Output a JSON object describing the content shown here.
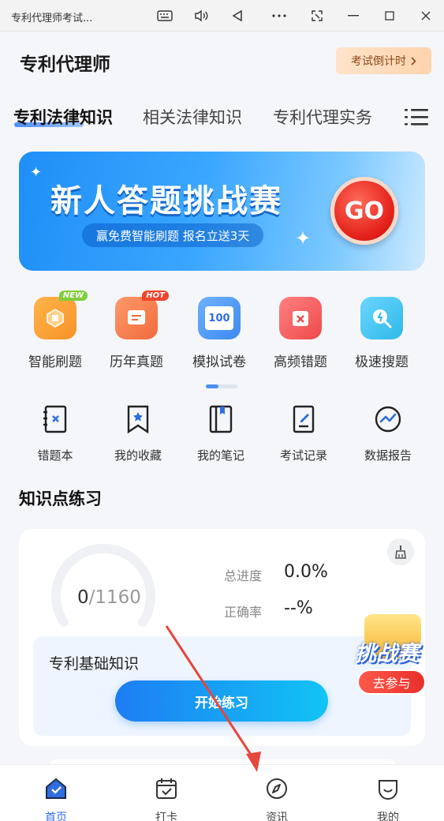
{
  "window": {
    "title": "专利代理师考试..."
  },
  "header": {
    "title": "专利代理师",
    "countdown_label": "考试倒计时"
  },
  "tabs": [
    {
      "label": "专利法律知识",
      "active": true
    },
    {
      "label": "相关法律知识",
      "active": false
    },
    {
      "label": "专利代理实务",
      "active": false
    }
  ],
  "banner": {
    "title": "新人答题挑战赛",
    "subtitle": "赢免费智能刷题 报名立送3天",
    "go_label": "GO"
  },
  "features": [
    {
      "label": "智能刷题",
      "badge": "NEW",
      "icon": "smart-practice-icon",
      "color": "#f7932b"
    },
    {
      "label": "历年真题",
      "badge": "HOT",
      "icon": "past-papers-icon",
      "color": "#f06a3c"
    },
    {
      "label": "模拟试卷",
      "badge": "",
      "icon": "mock-exam-icon",
      "icon_text": "100",
      "color": "#3b8af0"
    },
    {
      "label": "高频错题",
      "badge": "",
      "icon": "frequent-mistakes-icon",
      "color": "#ef4b4b"
    },
    {
      "label": "极速搜题",
      "badge": "",
      "icon": "quick-search-icon",
      "color": "#2fb8e8"
    }
  ],
  "tools": [
    {
      "label": "错题本",
      "icon": "mistake-book-icon"
    },
    {
      "label": "我的收藏",
      "icon": "favorites-icon"
    },
    {
      "label": "我的笔记",
      "icon": "notes-icon"
    },
    {
      "label": "考试记录",
      "icon": "exam-record-icon"
    },
    {
      "label": "数据报告",
      "icon": "data-report-icon"
    }
  ],
  "practice": {
    "section_title": "知识点练习",
    "done": "0",
    "total": "/1160",
    "progress_label": "总进度",
    "progress_value": "0.0%",
    "accuracy_label": "正确率",
    "accuracy_value": "--%",
    "subject": "专利基础知识",
    "start_label": "开始练习"
  },
  "floating": {
    "title": "挑战赛",
    "button": "去参与"
  },
  "nav": [
    {
      "label": "首页",
      "icon": "home-icon",
      "active": true
    },
    {
      "label": "打卡",
      "icon": "calendar-check-icon",
      "active": false
    },
    {
      "label": "资讯",
      "icon": "compass-icon",
      "active": false
    },
    {
      "label": "我的",
      "icon": "profile-icon",
      "active": false
    }
  ],
  "colors": {
    "accent": "#2f6de0",
    "banner_start": "#1f8ff7",
    "countdown_text": "#8a4a1c",
    "annotation_arrow": "#e5473a"
  }
}
